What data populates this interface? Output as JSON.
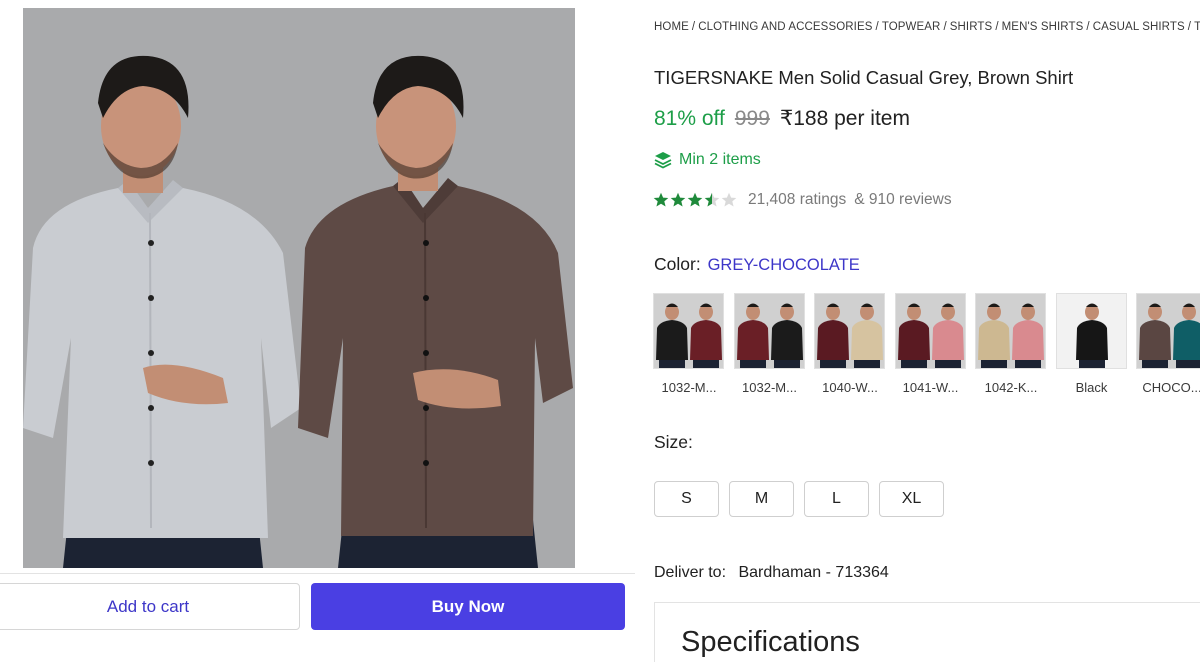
{
  "breadcrumb": [
    "HOME",
    "CLOTHING AND ACCESSORIES",
    "TOPWEAR",
    "SHIRTS",
    "MEN'S SHIRTS",
    "CASUAL SHIRTS",
    "T"
  ],
  "product": {
    "title": "TIGERSNAKE Men Solid Casual Grey, Brown Shirt",
    "discount": "81% off",
    "mrp": "999",
    "price": "₹188 per item",
    "min_items": "Min 2 items",
    "rating_value": 3.5,
    "ratings_count": "21,408 ratings",
    "reviews_count": "& 910 reviews"
  },
  "color": {
    "label": "Color:",
    "selected": "GREY-CHOCOLATE",
    "options": [
      {
        "caption": "1032-M...",
        "shirts": [
          "#1b1b1b",
          "#6a1f26"
        ]
      },
      {
        "caption": "1032-M...",
        "shirts": [
          "#6a1f26",
          "#1b1b1b"
        ]
      },
      {
        "caption": "1040-W...",
        "shirts": [
          "#5a1a22",
          "#d6c3a0"
        ]
      },
      {
        "caption": "1041-W...",
        "shirts": [
          "#5a1a22",
          "#d98a8f"
        ]
      },
      {
        "caption": "1042-K...",
        "shirts": [
          "#cdb891",
          "#d98a8f"
        ]
      },
      {
        "caption": "Black",
        "shirts": [
          "#161616"
        ]
      },
      {
        "caption": "CHOCO...",
        "shirts": [
          "#5a4642",
          "#0f5e66"
        ]
      }
    ]
  },
  "size": {
    "label": "Size:",
    "options": [
      "S",
      "M",
      "L",
      "XL"
    ]
  },
  "delivery": {
    "label": "Deliver to:",
    "location": "Bardhaman - 713364"
  },
  "specifications": {
    "title": "Specifications"
  },
  "actions": {
    "add_to_cart": "Add to cart",
    "buy_now": "Buy Now"
  },
  "colors": {
    "accent": "#4a3fe3",
    "discount_green": "#1d9e48",
    "star_green": "#1f8a3b",
    "link_blue": "#3d36c8",
    "image_bg": "#a9aaac"
  }
}
